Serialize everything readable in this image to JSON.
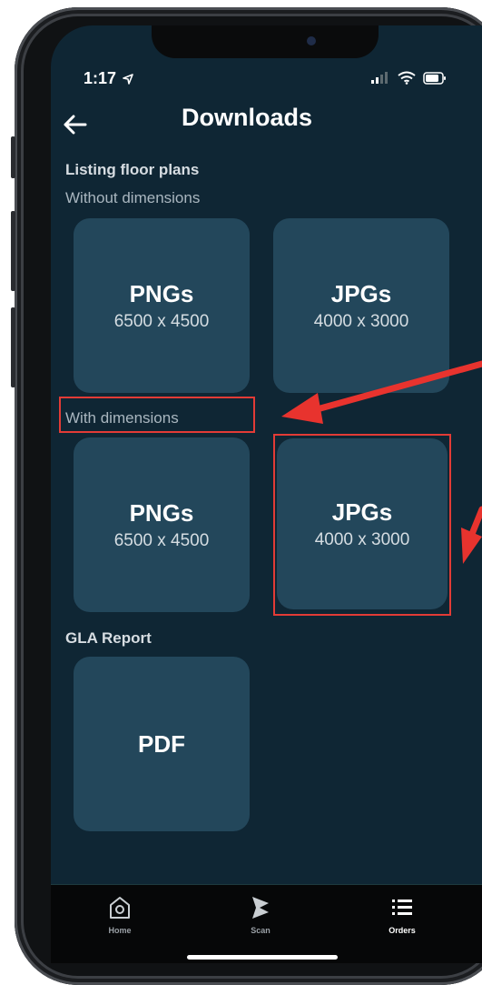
{
  "status_bar": {
    "time": "1:17"
  },
  "header": {
    "title": "Downloads"
  },
  "sections": [
    {
      "title": "Listing floor plans",
      "subtitle": "Without dimensions",
      "tiles": [
        {
          "title": "PNGs",
          "subtitle": "6500 x 4500"
        },
        {
          "title": "JPGs",
          "subtitle": "4000 x 3000"
        }
      ]
    },
    {
      "title": "",
      "subtitle": "With dimensions",
      "tiles": [
        {
          "title": "PNGs",
          "subtitle": "6500 x 4500"
        },
        {
          "title": "JPGs",
          "subtitle": "4000 x 3000"
        }
      ]
    },
    {
      "title": "GLA Report",
      "subtitle": "",
      "tiles": [
        {
          "title": "PDF",
          "subtitle": ""
        }
      ]
    }
  ],
  "tab_bar": {
    "items": [
      {
        "label": "Home",
        "icon": "home-icon"
      },
      {
        "label": "Scan",
        "icon": "scan-icon"
      },
      {
        "label": "Orders",
        "icon": "list-icon",
        "active": true
      }
    ]
  },
  "annotations": {
    "color": "#e23b36"
  },
  "colors": {
    "background": "#0f2634",
    "tile": "#23475b",
    "tab_bar": "#060708"
  }
}
